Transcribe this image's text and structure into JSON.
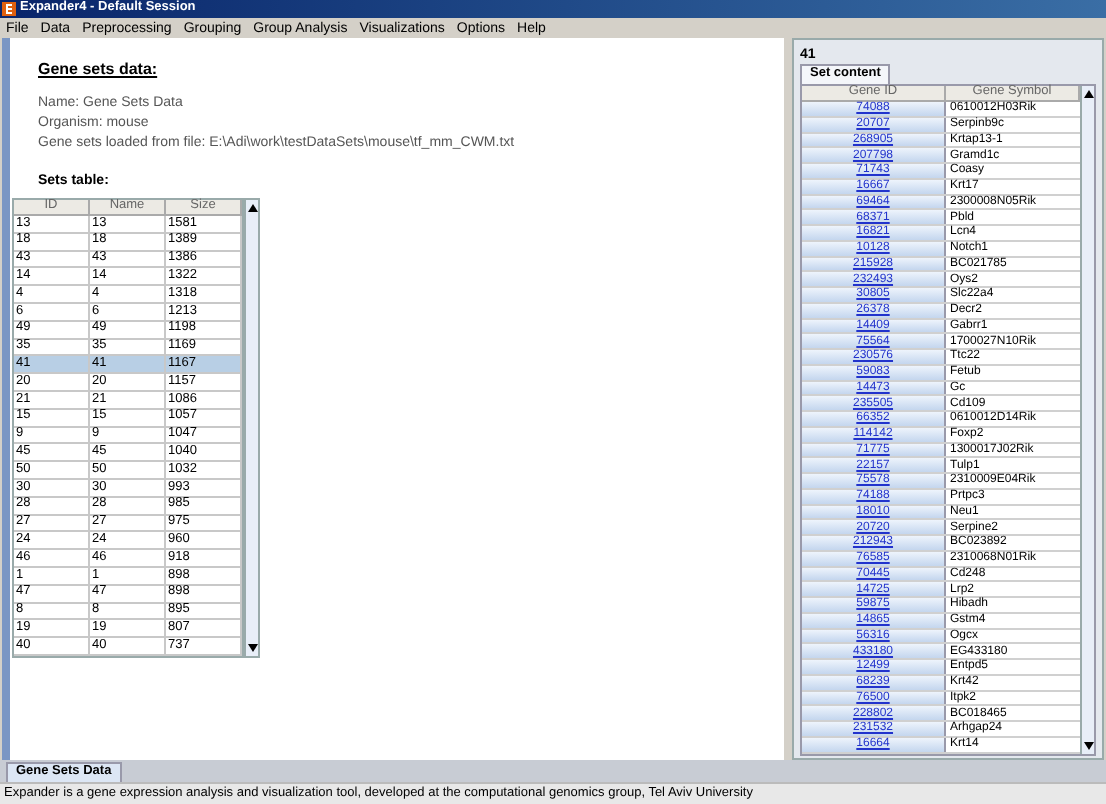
{
  "window": {
    "title": "Expander4 - Default Session"
  },
  "menu": [
    "File",
    "Data",
    "Preprocessing",
    "Grouping",
    "Group Analysis",
    "Visualizations",
    "Options",
    "Help"
  ],
  "info": {
    "heading": "Gene sets data:",
    "lines": [
      "Name: Gene Sets Data",
      "Organism: mouse",
      "Gene sets loaded from file: E:\\Adi\\work\\testDataSets\\mouse\\tf_mm_CWM.txt"
    ]
  },
  "sets_table": {
    "title": "Sets table:",
    "columns": [
      "ID",
      "Name",
      "Size"
    ],
    "rows": [
      {
        "cells": [
          "13",
          "13",
          "1581"
        ],
        "selected": false
      },
      {
        "cells": [
          "18",
          "18",
          "1389"
        ],
        "selected": false
      },
      {
        "cells": [
          "43",
          "43",
          "1386"
        ],
        "selected": false
      },
      {
        "cells": [
          "14",
          "14",
          "1322"
        ],
        "selected": false
      },
      {
        "cells": [
          "4",
          "4",
          "1318"
        ],
        "selected": false
      },
      {
        "cells": [
          "6",
          "6",
          "1213"
        ],
        "selected": false
      },
      {
        "cells": [
          "49",
          "49",
          "1198"
        ],
        "selected": false
      },
      {
        "cells": [
          "35",
          "35",
          "1169"
        ],
        "selected": false
      },
      {
        "cells": [
          "41",
          "41",
          "1167"
        ],
        "selected": true
      },
      {
        "cells": [
          "20",
          "20",
          "1157"
        ],
        "selected": false
      },
      {
        "cells": [
          "21",
          "21",
          "1086"
        ],
        "selected": false
      },
      {
        "cells": [
          "15",
          "15",
          "1057"
        ],
        "selected": false
      },
      {
        "cells": [
          "9",
          "9",
          "1047"
        ],
        "selected": false
      },
      {
        "cells": [
          "45",
          "45",
          "1040"
        ],
        "selected": false
      },
      {
        "cells": [
          "50",
          "50",
          "1032"
        ],
        "selected": false
      },
      {
        "cells": [
          "30",
          "30",
          "993"
        ],
        "selected": false
      },
      {
        "cells": [
          "28",
          "28",
          "985"
        ],
        "selected": false
      },
      {
        "cells": [
          "27",
          "27",
          "975"
        ],
        "selected": false
      },
      {
        "cells": [
          "24",
          "24",
          "960"
        ],
        "selected": false
      },
      {
        "cells": [
          "46",
          "46",
          "918"
        ],
        "selected": false
      },
      {
        "cells": [
          "1",
          "1",
          "898"
        ],
        "selected": false
      },
      {
        "cells": [
          "47",
          "47",
          "898"
        ],
        "selected": false
      },
      {
        "cells": [
          "8",
          "8",
          "895"
        ],
        "selected": false
      },
      {
        "cells": [
          "19",
          "19",
          "807"
        ],
        "selected": false
      },
      {
        "cells": [
          "40",
          "40",
          "737"
        ],
        "selected": false
      }
    ]
  },
  "set_panel": {
    "header": "41",
    "tabs": [
      {
        "label": "Set content",
        "selected": true
      }
    ],
    "columns": [
      "Gene ID",
      "Gene Symbol"
    ],
    "rows": [
      [
        "74088",
        "0610012H03Rik"
      ],
      [
        "20707",
        "Serpinb9c"
      ],
      [
        "268905",
        "Krtap13-1"
      ],
      [
        "207798",
        "Gramd1c"
      ],
      [
        "71743",
        "Coasy"
      ],
      [
        "16667",
        "Krt17"
      ],
      [
        "69464",
        "2300008N05Rik"
      ],
      [
        "68371",
        "Pbld"
      ],
      [
        "16821",
        "Lcn4"
      ],
      [
        "10128",
        "Notch1"
      ],
      [
        "215928",
        "BC021785"
      ],
      [
        "232493",
        "Oys2"
      ],
      [
        "30805",
        "Slc22a4"
      ],
      [
        "26378",
        "Decr2"
      ],
      [
        "14409",
        "Gabrr1"
      ],
      [
        "75564",
        "1700027N10Rik"
      ],
      [
        "230576",
        "Ttc22"
      ],
      [
        "59083",
        "Fetub"
      ],
      [
        "14473",
        "Gc"
      ],
      [
        "235505",
        "Cd109"
      ],
      [
        "66352",
        "0610012D14Rik"
      ],
      [
        "114142",
        "Foxp2"
      ],
      [
        "71775",
        "1300017J02Rik"
      ],
      [
        "22157",
        "Tulp1"
      ],
      [
        "75578",
        "2310009E04Rik"
      ],
      [
        "74188",
        "Prtpc3"
      ],
      [
        "18010",
        "Neu1"
      ],
      [
        "20720",
        "Serpine2"
      ],
      [
        "212943",
        "BC023892"
      ],
      [
        "76585",
        "2310068N01Rik"
      ],
      [
        "70445",
        "Cd248"
      ],
      [
        "14725",
        "Lrp2"
      ],
      [
        "59875",
        "Hibadh"
      ],
      [
        "14865",
        "Gstm4"
      ],
      [
        "56316",
        "Ogcx"
      ],
      [
        "433180",
        "EG433180"
      ],
      [
        "12499",
        "Entpd5"
      ],
      [
        "68239",
        "Krt42"
      ],
      [
        "76500",
        "Itpk2"
      ],
      [
        "228802",
        "BC018465"
      ],
      [
        "231532",
        "Arhgap24"
      ],
      [
        "16664",
        "Krt14"
      ]
    ]
  },
  "bottom_tabs": [
    {
      "label": "Gene Sets Data",
      "selected": true
    }
  ],
  "status_bar": "Expander is a gene expression analysis and visualization tool, developed at the computational genomics group, Tel Aviv University"
}
